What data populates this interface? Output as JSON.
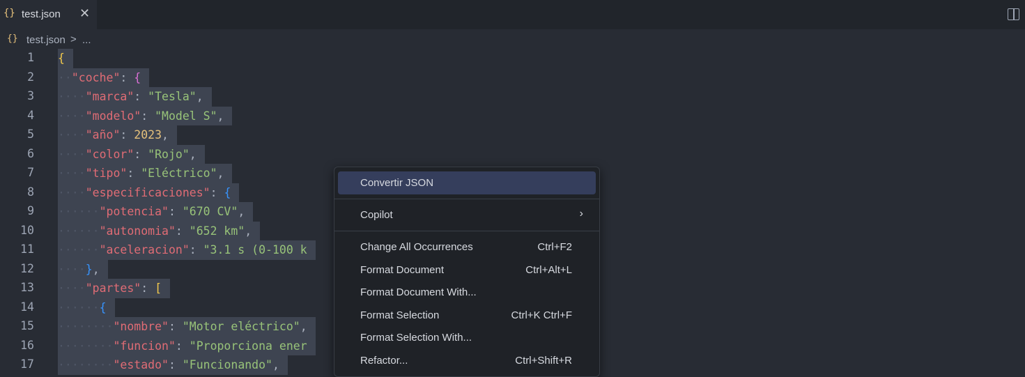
{
  "tab": {
    "icon": "{}",
    "label": "test.json",
    "close": "✕"
  },
  "breadcrumb": {
    "icon": "{}",
    "file": "test.json",
    "separator": ">",
    "more": "..."
  },
  "editor": {
    "line_numbers": [
      "1",
      "2",
      "3",
      "4",
      "5",
      "6",
      "7",
      "8",
      "9",
      "10",
      "11",
      "12",
      "13",
      "14",
      "15",
      "16",
      "17"
    ],
    "lines": {
      "l1": {
        "ob": "{"
      },
      "l2": {
        "key": "\"coche\"",
        "colon": ": ",
        "ob": "{"
      },
      "l3": {
        "key": "\"marca\"",
        "colon": ": ",
        "val": "\"Tesla\"",
        "comma": ","
      },
      "l4": {
        "key": "\"modelo\"",
        "colon": ": ",
        "val": "\"Model S\"",
        "comma": ","
      },
      "l5": {
        "key": "\"año\"",
        "colon": ": ",
        "val": "2023",
        "comma": ","
      },
      "l6": {
        "key": "\"color\"",
        "colon": ": ",
        "val": "\"Rojo\"",
        "comma": ","
      },
      "l7": {
        "key": "\"tipo\"",
        "colon": ": ",
        "val": "\"Eléctrico\"",
        "comma": ","
      },
      "l8": {
        "key": "\"especificaciones\"",
        "colon": ": ",
        "ob": "{"
      },
      "l9": {
        "key": "\"potencia\"",
        "colon": ": ",
        "val": "\"670 CV\"",
        "comma": ","
      },
      "l10": {
        "key": "\"autonomia\"",
        "colon": ": ",
        "val": "\"652 km\"",
        "comma": ","
      },
      "l11": {
        "key": "\"aceleracion\"",
        "colon": ": ",
        "val": "\"3.1 s (0-100 k"
      },
      "l12": {
        "cb": "}",
        "comma": ","
      },
      "l13": {
        "key": "\"partes\"",
        "colon": ": ",
        "ob": "["
      },
      "l14": {
        "ob": "{"
      },
      "l15": {
        "key": "\"nombre\"",
        "colon": ": ",
        "val": "\"Motor eléctrico\"",
        "comma": ","
      },
      "l16": {
        "key": "\"funcion\"",
        "colon": ": ",
        "val": "\"Proporciona ener"
      },
      "l17": {
        "key": "\"estado\"",
        "colon": ": ",
        "val": "\"Funcionando\"",
        "comma": ","
      }
    }
  },
  "context_menu": {
    "convert_json": "Convertir JSON",
    "copilot": "Copilot",
    "change_all": {
      "label": "Change All Occurrences",
      "shortcut": "Ctrl+F2"
    },
    "format_document": {
      "label": "Format Document",
      "shortcut": "Ctrl+Alt+L"
    },
    "format_document_with": {
      "label": "Format Document With..."
    },
    "format_selection": {
      "label": "Format Selection",
      "shortcut": "Ctrl+K Ctrl+F"
    },
    "format_selection_with": {
      "label": "Format Selection With..."
    },
    "refactor": {
      "label": "Refactor...",
      "shortcut": "Ctrl+Shift+R"
    }
  }
}
